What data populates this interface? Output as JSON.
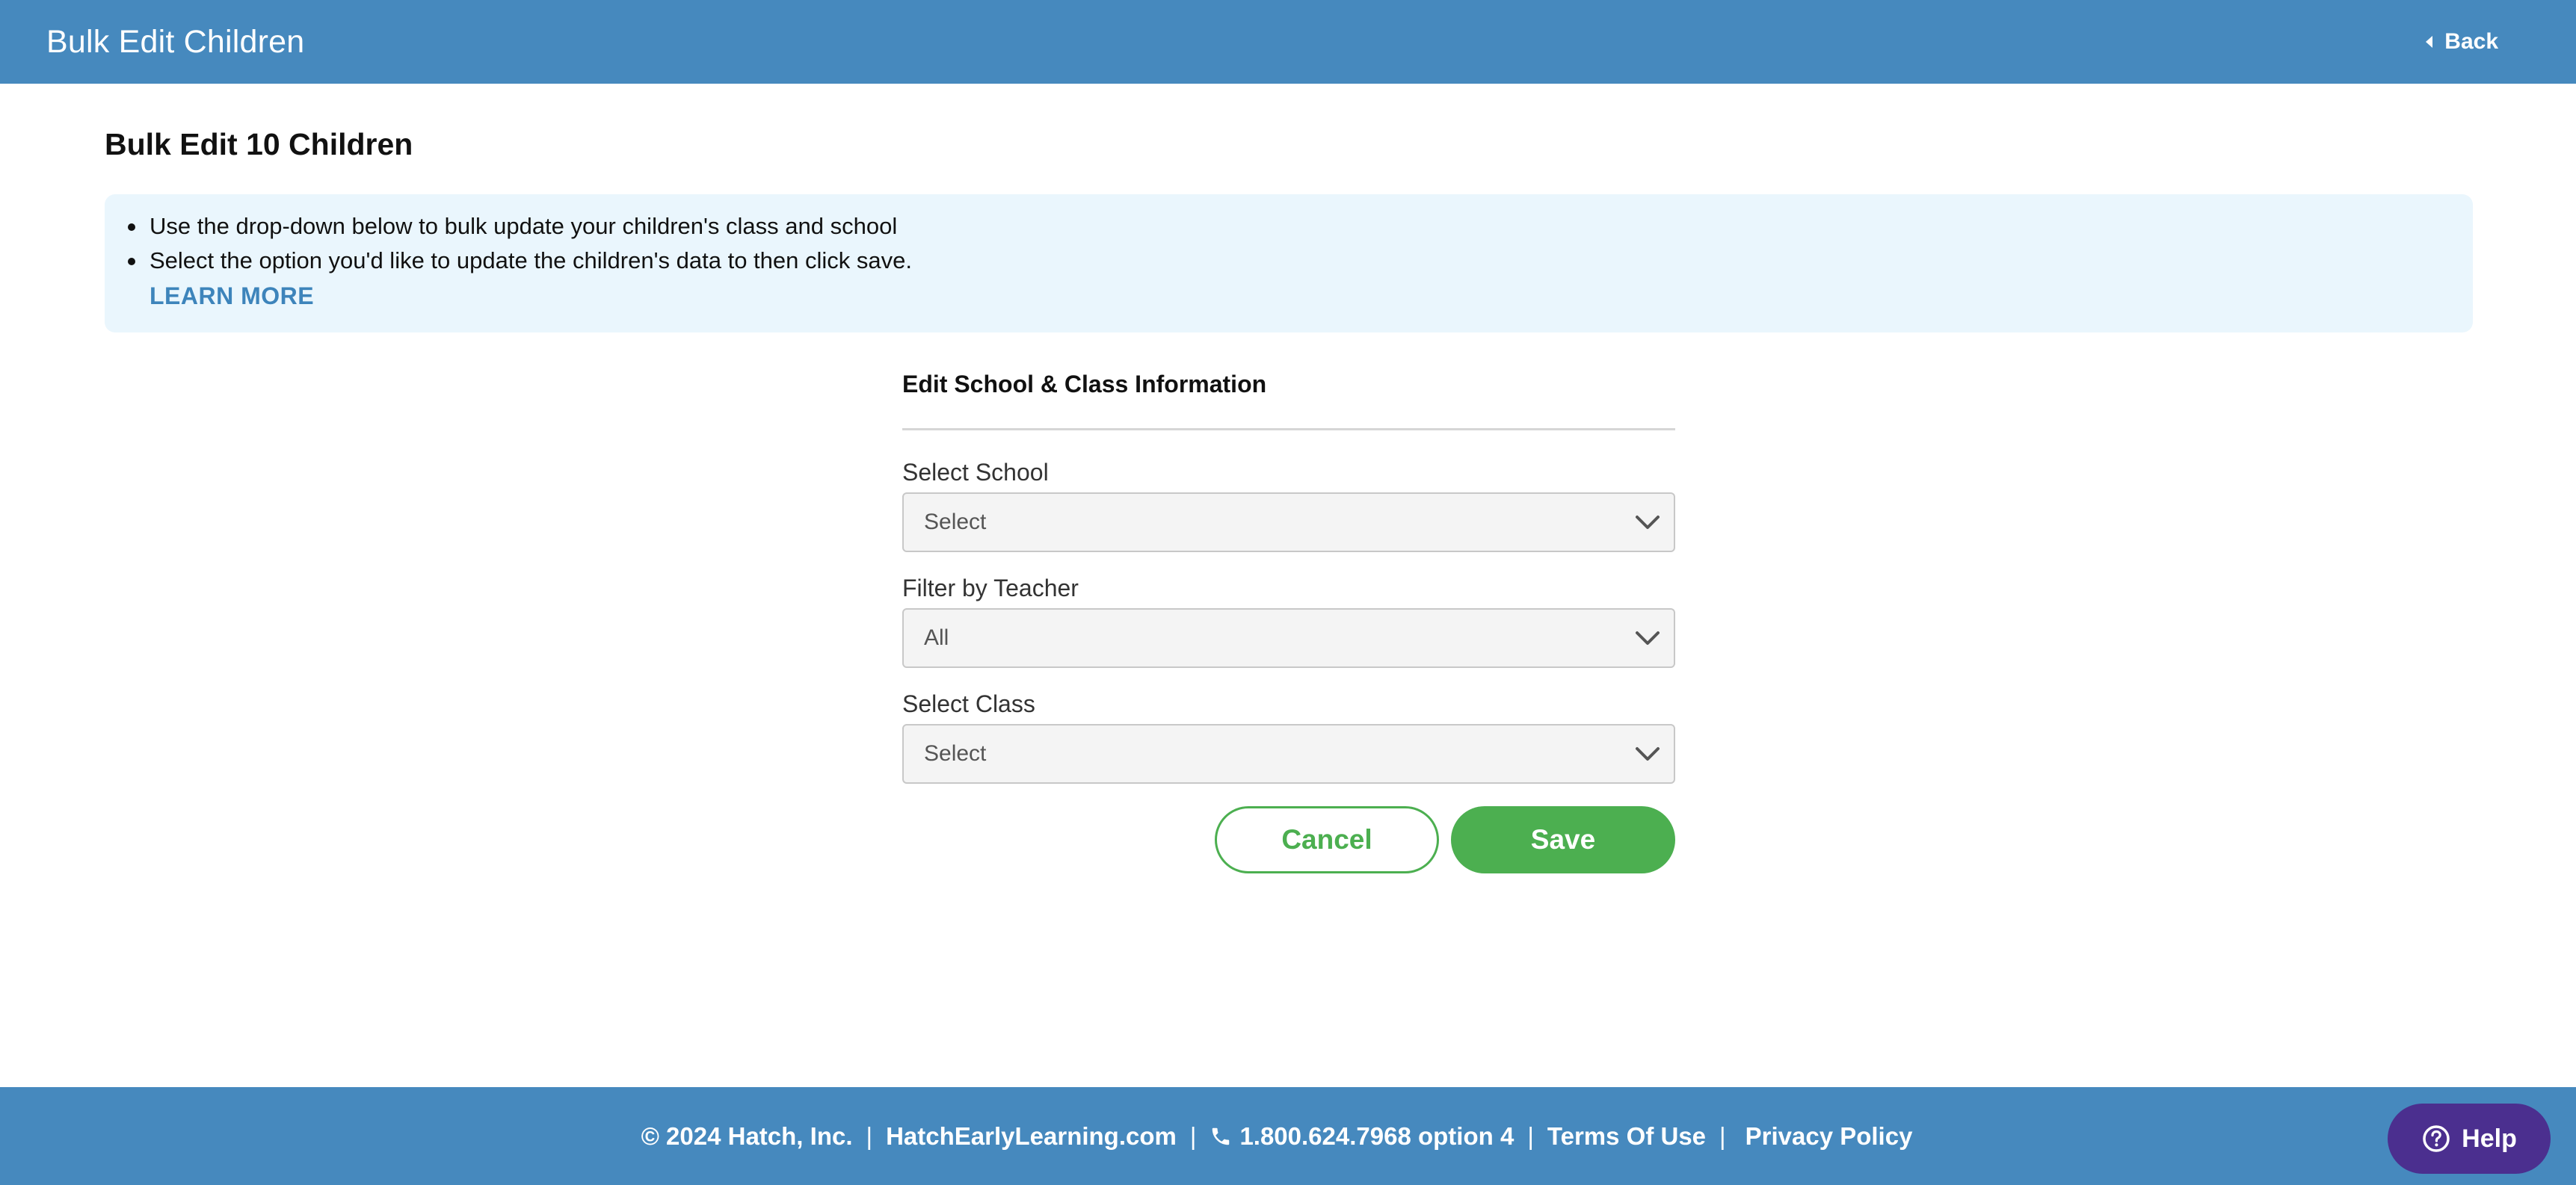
{
  "header": {
    "title": "Bulk Edit Children",
    "back_label": "Back"
  },
  "main": {
    "heading": "Bulk Edit 10 Children",
    "info": {
      "bullets": [
        "Use the drop-down below to bulk update your children's class and school",
        "Select the option you'd like to update the children's data to then click save."
      ],
      "learn_more": "LEARN MORE"
    },
    "form": {
      "section_title": "Edit School & Class Information",
      "fields": [
        {
          "label": "Select School",
          "value": "Select"
        },
        {
          "label": "Filter by Teacher",
          "value": "All"
        },
        {
          "label": "Select Class",
          "value": "Select"
        }
      ],
      "cancel_label": "Cancel",
      "save_label": "Save"
    }
  },
  "footer": {
    "copyright": "© 2024 Hatch, Inc.",
    "website": "HatchEarlyLearning.com",
    "phone": "1.800.624.7968 option 4",
    "terms": "Terms Of Use",
    "privacy": "Privacy Policy",
    "separator": "|"
  },
  "help": {
    "label": "Help"
  },
  "colors": {
    "header_bg": "#4689be",
    "info_bg": "#eaf6fd",
    "link": "#3d84bb",
    "accent_green": "#4caf50",
    "help_bg": "#4b2f8f"
  },
  "icons": [
    "caret-left-icon",
    "chevron-down-icon",
    "phone-icon",
    "question-circle-icon"
  ]
}
